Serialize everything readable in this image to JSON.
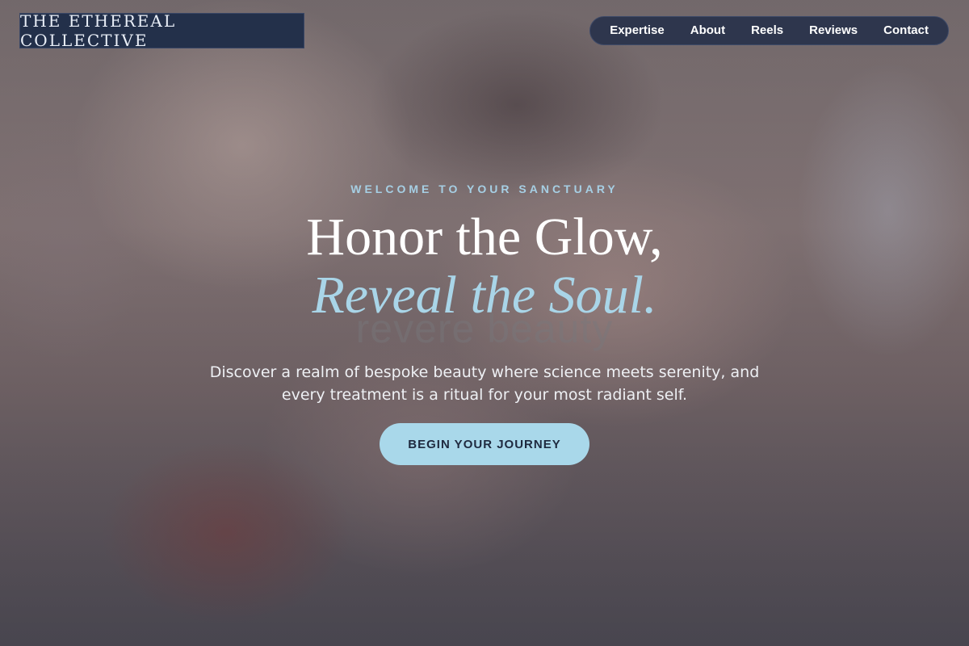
{
  "brand": {
    "name": "THE ETHEREAL COLLECTIVE"
  },
  "nav": {
    "items": [
      {
        "label": "Expertise"
      },
      {
        "label": "About"
      },
      {
        "label": "Reels"
      },
      {
        "label": "Reviews"
      },
      {
        "label": "Contact"
      }
    ]
  },
  "hero": {
    "eyebrow": "WELCOME TO YOUR SANCTUARY",
    "title_line1": "Honor the Glow,",
    "title_line2": "Reveal the Soul.",
    "watermark": "revere beauty",
    "description": "Discover a realm of bespoke beauty where science meets serenity, and every treatment is a ritual for your most radiant self.",
    "cta_label": "BEGIN YOUR JOURNEY"
  },
  "colors": {
    "brand_bg": "#23304a",
    "nav_bg": "#28324b",
    "accent": "#a9d8ea",
    "cta_text": "#1f2a3f"
  }
}
